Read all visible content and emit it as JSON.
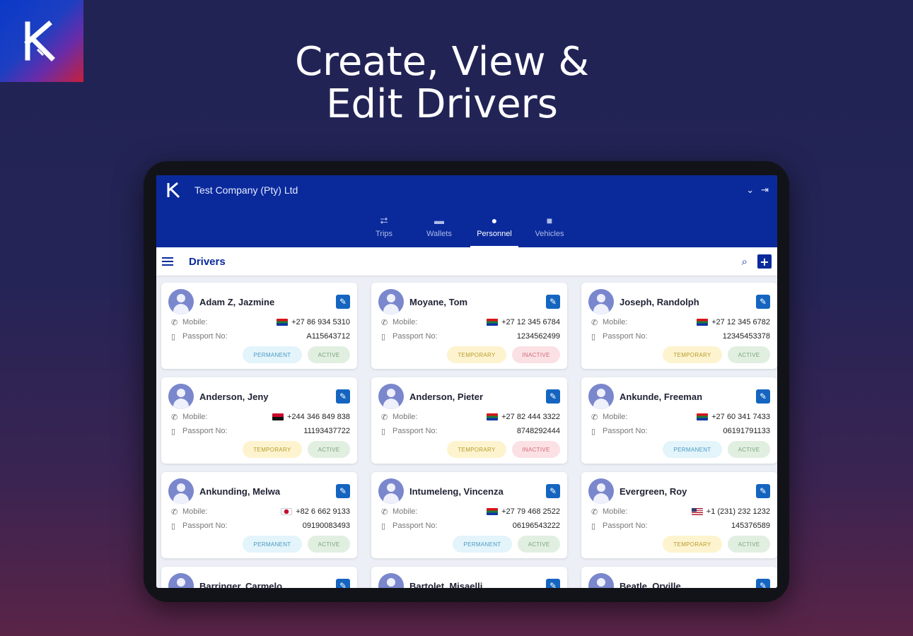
{
  "headline": {
    "line1": "Create, View &",
    "line2": "Edit Drivers"
  },
  "app": {
    "company": "Test Company (Pty) Ltd",
    "nav": [
      {
        "label": "Trips",
        "icon": "trips-icon"
      },
      {
        "label": "Wallets",
        "icon": "wallet-icon"
      },
      {
        "label": "Personnel",
        "icon": "person-icon",
        "active": true
      },
      {
        "label": "Vehicles",
        "icon": "truck-icon"
      }
    ],
    "page_title": "Drivers",
    "mobile_label": "Mobile:",
    "passport_label": "Passport No:",
    "drivers": [
      {
        "name": "Adam Z, Jazmine",
        "flag": "za",
        "mobile": "+27 86 934 5310",
        "passport": "A115643712",
        "type": "PERMANENT",
        "status": "ACTIVE"
      },
      {
        "name": "Moyane, Tom",
        "flag": "za",
        "mobile": "+27 12 345 6784",
        "passport": "1234562499",
        "type": "TEMPORARY",
        "status": "INACTIVE"
      },
      {
        "name": "Joseph, Randolph",
        "flag": "za",
        "mobile": "+27 12 345 6782",
        "passport": "12345453378",
        "type": "TEMPORARY",
        "status": "ACTIVE"
      },
      {
        "name": "Anderson, Jeny",
        "flag": "ao",
        "mobile": "+244 346 849 838",
        "passport": "11193437722",
        "type": "TEMPORARY",
        "status": "ACTIVE"
      },
      {
        "name": "Anderson, Pieter",
        "flag": "za",
        "mobile": "+27 82 444 3322",
        "passport": "8748292444",
        "type": "TEMPORARY",
        "status": "INACTIVE"
      },
      {
        "name": "Ankunde, Freeman",
        "flag": "za",
        "mobile": "+27 60 341 7433",
        "passport": "06191791133",
        "type": "PERMANENT",
        "status": "ACTIVE"
      },
      {
        "name": "Ankunding, Melwa",
        "flag": "kr",
        "mobile": "+82 6 662 9133",
        "passport": "09190083493",
        "type": "PERMANENT",
        "status": "ACTIVE"
      },
      {
        "name": "Intumeleng, Vincenza",
        "flag": "za",
        "mobile": "+27 79 468 2522",
        "passport": "06196543222",
        "type": "PERMANENT",
        "status": "ACTIVE"
      },
      {
        "name": "Evergreen, Roy",
        "flag": "us",
        "mobile": "+1 (231) 232 1232",
        "passport": "145376589",
        "type": "TEMPORARY",
        "status": "ACTIVE"
      },
      {
        "name": "Barringer, Carmelo"
      },
      {
        "name": "Bartolet, Misaelli"
      },
      {
        "name": "Beatle, Orville"
      }
    ]
  }
}
